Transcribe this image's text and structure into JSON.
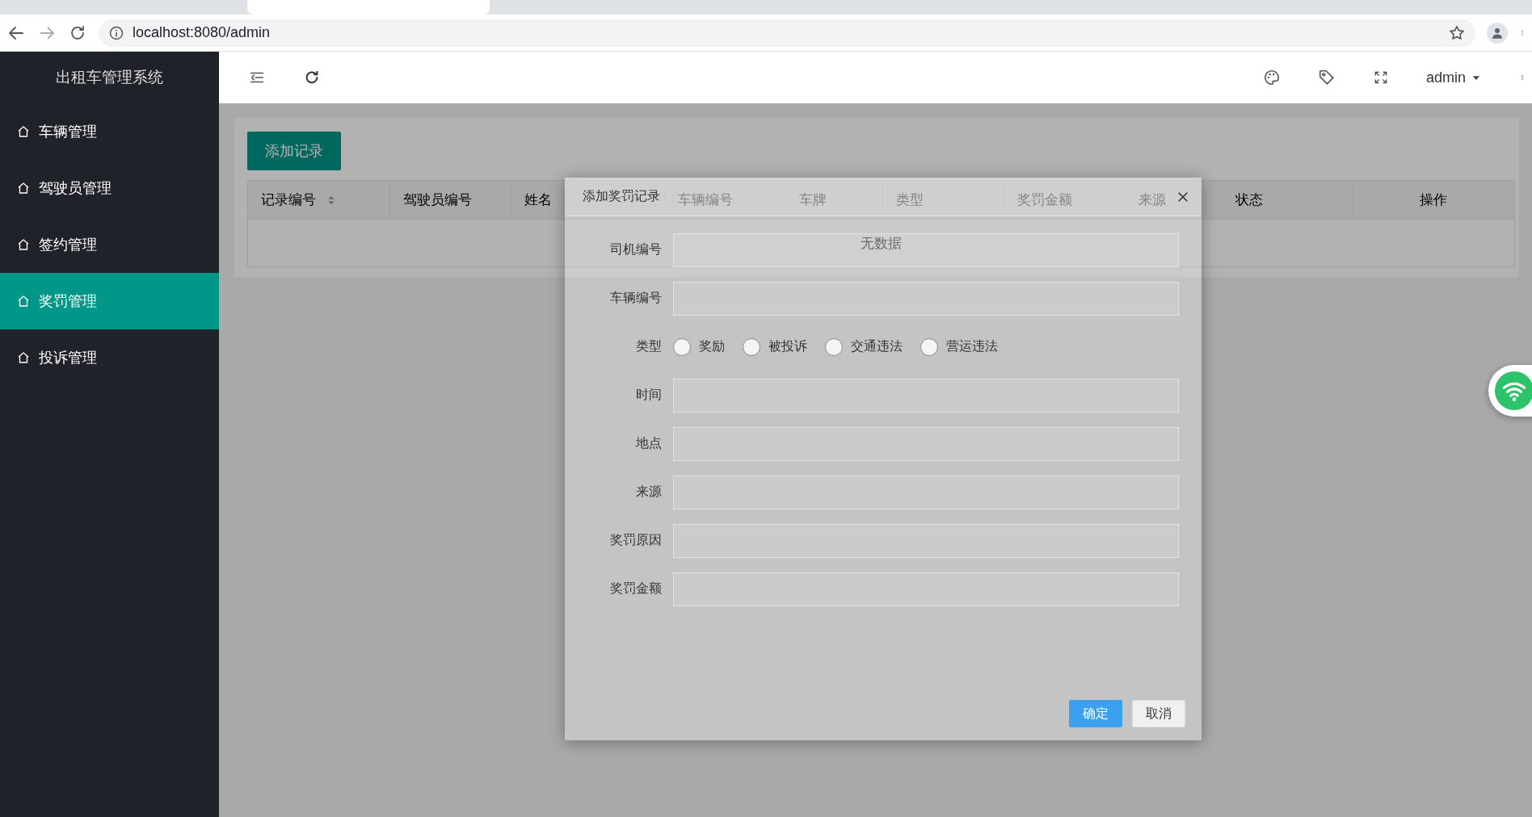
{
  "browser": {
    "url": "localhost:8080/admin"
  },
  "app": {
    "title": "出租车管理系统",
    "user": "admin"
  },
  "sidebar": {
    "items": [
      {
        "label": "车辆管理",
        "selected": false
      },
      {
        "label": "驾驶员管理",
        "selected": false
      },
      {
        "label": "签约管理",
        "selected": false
      },
      {
        "label": "奖罚管理",
        "selected": true
      },
      {
        "label": "投诉管理",
        "selected": false
      }
    ]
  },
  "toolbar": {
    "add_button": "添加记录"
  },
  "table": {
    "columns": [
      {
        "label": "记录编号",
        "sortable": true
      },
      {
        "label": "驾驶员编号",
        "sortable": false
      },
      {
        "label": "姓名",
        "sortable": false
      },
      {
        "label": "车辆编号",
        "sortable": false
      },
      {
        "label": "车牌",
        "sortable": false
      },
      {
        "label": "类型",
        "sortable": false
      },
      {
        "label": "奖罚金额",
        "sortable": false
      },
      {
        "label": "来源",
        "sortable": false
      },
      {
        "label": "状态",
        "sortable": false
      },
      {
        "label": "操作",
        "sortable": false
      }
    ],
    "empty_text": "无数据"
  },
  "dialog": {
    "title": "添加奖罚记录",
    "fields": [
      {
        "kind": "input",
        "label": "司机编号"
      },
      {
        "kind": "input",
        "label": "车辆编号"
      },
      {
        "kind": "radio",
        "label": "类型",
        "options": [
          {
            "label": "奖励",
            "selected": false
          },
          {
            "label": "被投诉",
            "selected": false
          },
          {
            "label": "交通违法",
            "selected": false
          },
          {
            "label": "营运违法",
            "selected": false
          }
        ]
      },
      {
        "kind": "input",
        "label": "时间"
      },
      {
        "kind": "input",
        "label": "地点"
      },
      {
        "kind": "input",
        "label": "来源"
      },
      {
        "kind": "input",
        "label": "奖罚原因"
      },
      {
        "kind": "input",
        "label": "奖罚金额"
      }
    ],
    "buttons": [
      {
        "label": "确定",
        "kind": "primary"
      },
      {
        "label": "取消",
        "kind": "default"
      }
    ]
  }
}
